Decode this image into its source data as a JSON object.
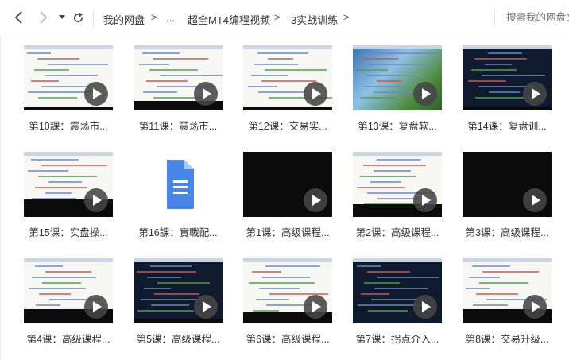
{
  "breadcrumb": {
    "root": "我的网盘",
    "ellipsis": "...",
    "level1": "超全MT4编程视频",
    "level2": "3实战训练",
    "sep": ">"
  },
  "search": {
    "placeholder": "搜索我的网盘文件"
  },
  "files": [
    {
      "label": "第10課：震荡市...",
      "type": "video"
    },
    {
      "label": "第11课：震荡市...",
      "type": "video"
    },
    {
      "label": "第12课：交易实...",
      "type": "video"
    },
    {
      "label": "第13课：复盘软...",
      "type": "video"
    },
    {
      "label": "第14课：复盘训...",
      "type": "video"
    },
    {
      "label": "第15课：实盘操...",
      "type": "video"
    },
    {
      "label": "第16課：實戰配...",
      "type": "document"
    },
    {
      "label": "第1课：高级课程...",
      "type": "video"
    },
    {
      "label": "第2课：高级课程...",
      "type": "video"
    },
    {
      "label": "第3课：高级课程...",
      "type": "video"
    },
    {
      "label": "第4课：高级课程...",
      "type": "video"
    },
    {
      "label": "第5课：高级课程...",
      "type": "video"
    },
    {
      "label": "第6课：高级课程...",
      "type": "video"
    },
    {
      "label": "第7课：拐点介入...",
      "type": "video"
    },
    {
      "label": "第8课：交易升级...",
      "type": "video"
    }
  ],
  "colors": {
    "doc_icon": "#4a86e8",
    "play_overlay": "#464646"
  }
}
